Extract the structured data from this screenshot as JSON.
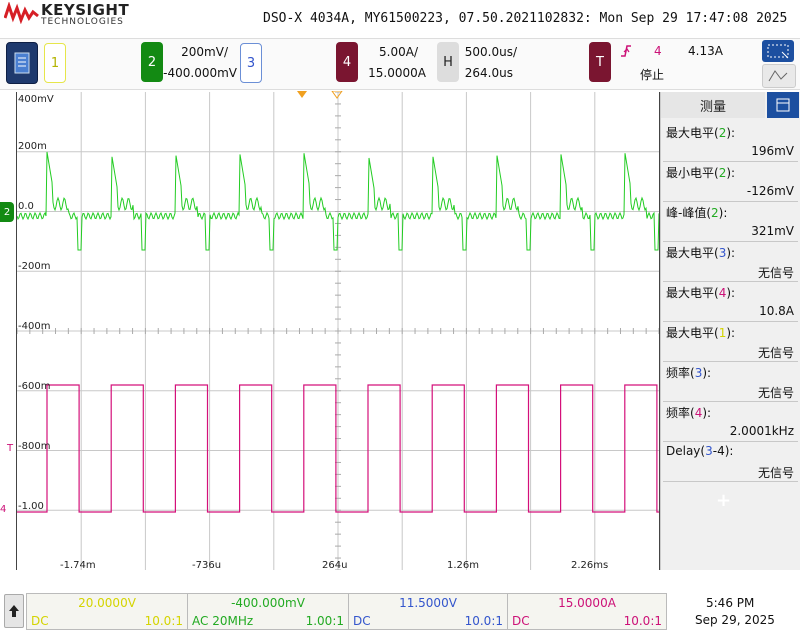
{
  "header": {
    "brand": "KEYSIGHT",
    "brand_sub": "TECHNOLOGIES",
    "title": "DSO-X 4034A, MY61500223, 07.50.2021102832: Mon Sep 29 17:47:08 2025"
  },
  "channels": {
    "ch1": {
      "number": "1",
      "color": "#d4d400"
    },
    "ch2": {
      "number": "2",
      "scale": "200mV/",
      "offset": "-400.000mV",
      "color": "#22aa22"
    },
    "ch3": {
      "number": "3",
      "color": "#3355cc"
    },
    "ch4": {
      "number": "4",
      "scale": "5.00A/",
      "offset": "15.0000A",
      "color": "#cc1177"
    },
    "horizontal": {
      "label": "H",
      "scale": "500.0us/",
      "delay": "264.0us"
    },
    "trigger": {
      "label": "T",
      "source": "4",
      "level": "4.13A",
      "status": "停止"
    }
  },
  "graticule": {
    "y_labels": [
      "400mV",
      "200m",
      "0.0",
      "-200m",
      "-400m",
      "-600m",
      "-800m",
      "-1.00"
    ],
    "x_labels": [
      "-1.74m",
      "-736u",
      "264u",
      "1.26m",
      "2.26ms"
    ],
    "ch2_marker": "2",
    "ch4_marker": "4",
    "trig_marker": "T"
  },
  "measurements": {
    "title": "测量",
    "items": [
      {
        "label_a": "最大电平(",
        "ch": "2",
        "label_b": "):",
        "ch_color": "#22aa22",
        "value": "196mV"
      },
      {
        "label_a": "最小电平(",
        "ch": "2",
        "label_b": "):",
        "ch_color": "#22aa22",
        "value": "-126mV"
      },
      {
        "label_a": "峰-峰值(",
        "ch": "2",
        "label_b": "):",
        "ch_color": "#22aa22",
        "value": "321mV"
      },
      {
        "label_a": "最大电平(",
        "ch": "3",
        "label_b": "):",
        "ch_color": "#3355cc",
        "value": "无信号"
      },
      {
        "label_a": "最大电平(",
        "ch": "4",
        "label_b": "):",
        "ch_color": "#cc1177",
        "value": "10.8A"
      },
      {
        "label_a": "最大电平(",
        "ch": "1",
        "label_b": "):",
        "ch_color": "#d4d400",
        "value": "无信号"
      },
      {
        "label_a": "频率(",
        "ch": "3",
        "label_b": "):",
        "ch_color": "#3355cc",
        "value": "无信号"
      },
      {
        "label_a": "频率(",
        "ch": "4",
        "label_b": "):",
        "ch_color": "#cc1177",
        "value": "2.0001kHz"
      },
      {
        "label_a": "Delay(",
        "ch": "3",
        "label_b": "-4):",
        "ch_color": "#3355cc",
        "value": "无信号"
      }
    ],
    "add_symbol": "+"
  },
  "bottom": {
    "ch1": {
      "offset": "20.0000V",
      "coupling": "DC",
      "probe": "10.0:1",
      "color": "#d4d400"
    },
    "ch2": {
      "offset": "-400.000mV",
      "coupling": "AC 20MHz",
      "probe": "1.00:1",
      "color": "#22aa22"
    },
    "ch3": {
      "offset": "11.5000V",
      "coupling": "DC",
      "probe": "10.0:1",
      "color": "#3355cc"
    },
    "ch4": {
      "offset": "15.0000A",
      "coupling": "DC",
      "probe": "10.0:1",
      "color": "#cc1177"
    },
    "time": "5:46 PM",
    "date": "Sep 29, 2025"
  },
  "waveforms": {
    "ch2_period_ms": 0.5,
    "ch4_period_ms": 0.5,
    "ch4_high_A": 10.8,
    "ch2_max_mV": 196,
    "ch2_min_mV": -126
  }
}
